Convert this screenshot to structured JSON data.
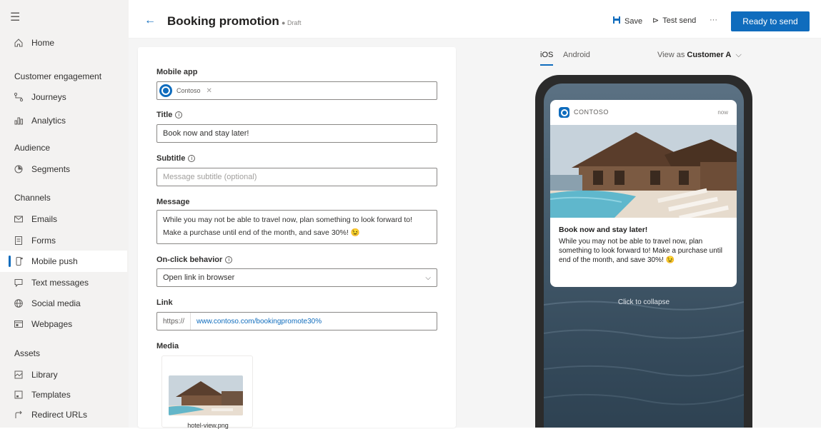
{
  "sidebar": {
    "home": "Home",
    "groups": {
      "customer_engagement": "Customer engagement",
      "audience": "Audience",
      "channels": "Channels",
      "assets": "Assets"
    },
    "items": {
      "journeys": "Journeys",
      "analytics": "Analytics",
      "segments": "Segments",
      "emails": "Emails",
      "forms": "Forms",
      "mobile_push": "Mobile push",
      "text_messages": "Text messages",
      "social_media": "Social media",
      "webpages": "Webpages",
      "library": "Library",
      "templates": "Templates",
      "redirect_urls": "Redirect URLs"
    },
    "active": "mobile_push"
  },
  "header": {
    "title": "Booking promotion",
    "status": "Draft",
    "save": "Save",
    "test_send": "Test send",
    "more": "···",
    "ready": "Ready to send"
  },
  "form": {
    "mobile_app_label": "Mobile app",
    "mobile_app_value": "Contoso",
    "title_label": "Title",
    "title_value": "Book now and stay later!",
    "subtitle_label": "Subtitle",
    "subtitle_placeholder": "Message subtitle (optional)",
    "message_label": "Message",
    "message_value": "While you may not be able to travel now, plan something to look forward to! Make a purchase until end of the month, and save 30%! 😉",
    "onclick_label": "On-click behavior",
    "onclick_value": "Open link in browser",
    "link_label": "Link",
    "link_prefix": "https://",
    "link_value": "www.contoso.com/bookingpromote30%",
    "media_label": "Media",
    "media_caption": "hotel-view.png"
  },
  "preview": {
    "tabs": [
      "iOS",
      "Android"
    ],
    "active_tab": "iOS",
    "view_as_prefix": "View as",
    "view_as_value": "Customer A",
    "notification": {
      "app_name": "CONTOSO",
      "time": "now",
      "title": "Book now and stay later!",
      "message": "While you may not be able to travel now, plan something to look forward to! Make a purchase until end of the month, and save 30%! 😉"
    },
    "collapse": "Click to collapse"
  },
  "colors": {
    "accent": "#0f6cbd",
    "sidebar_bg": "#f3f2f1",
    "content_bg": "#f5f5f5"
  }
}
